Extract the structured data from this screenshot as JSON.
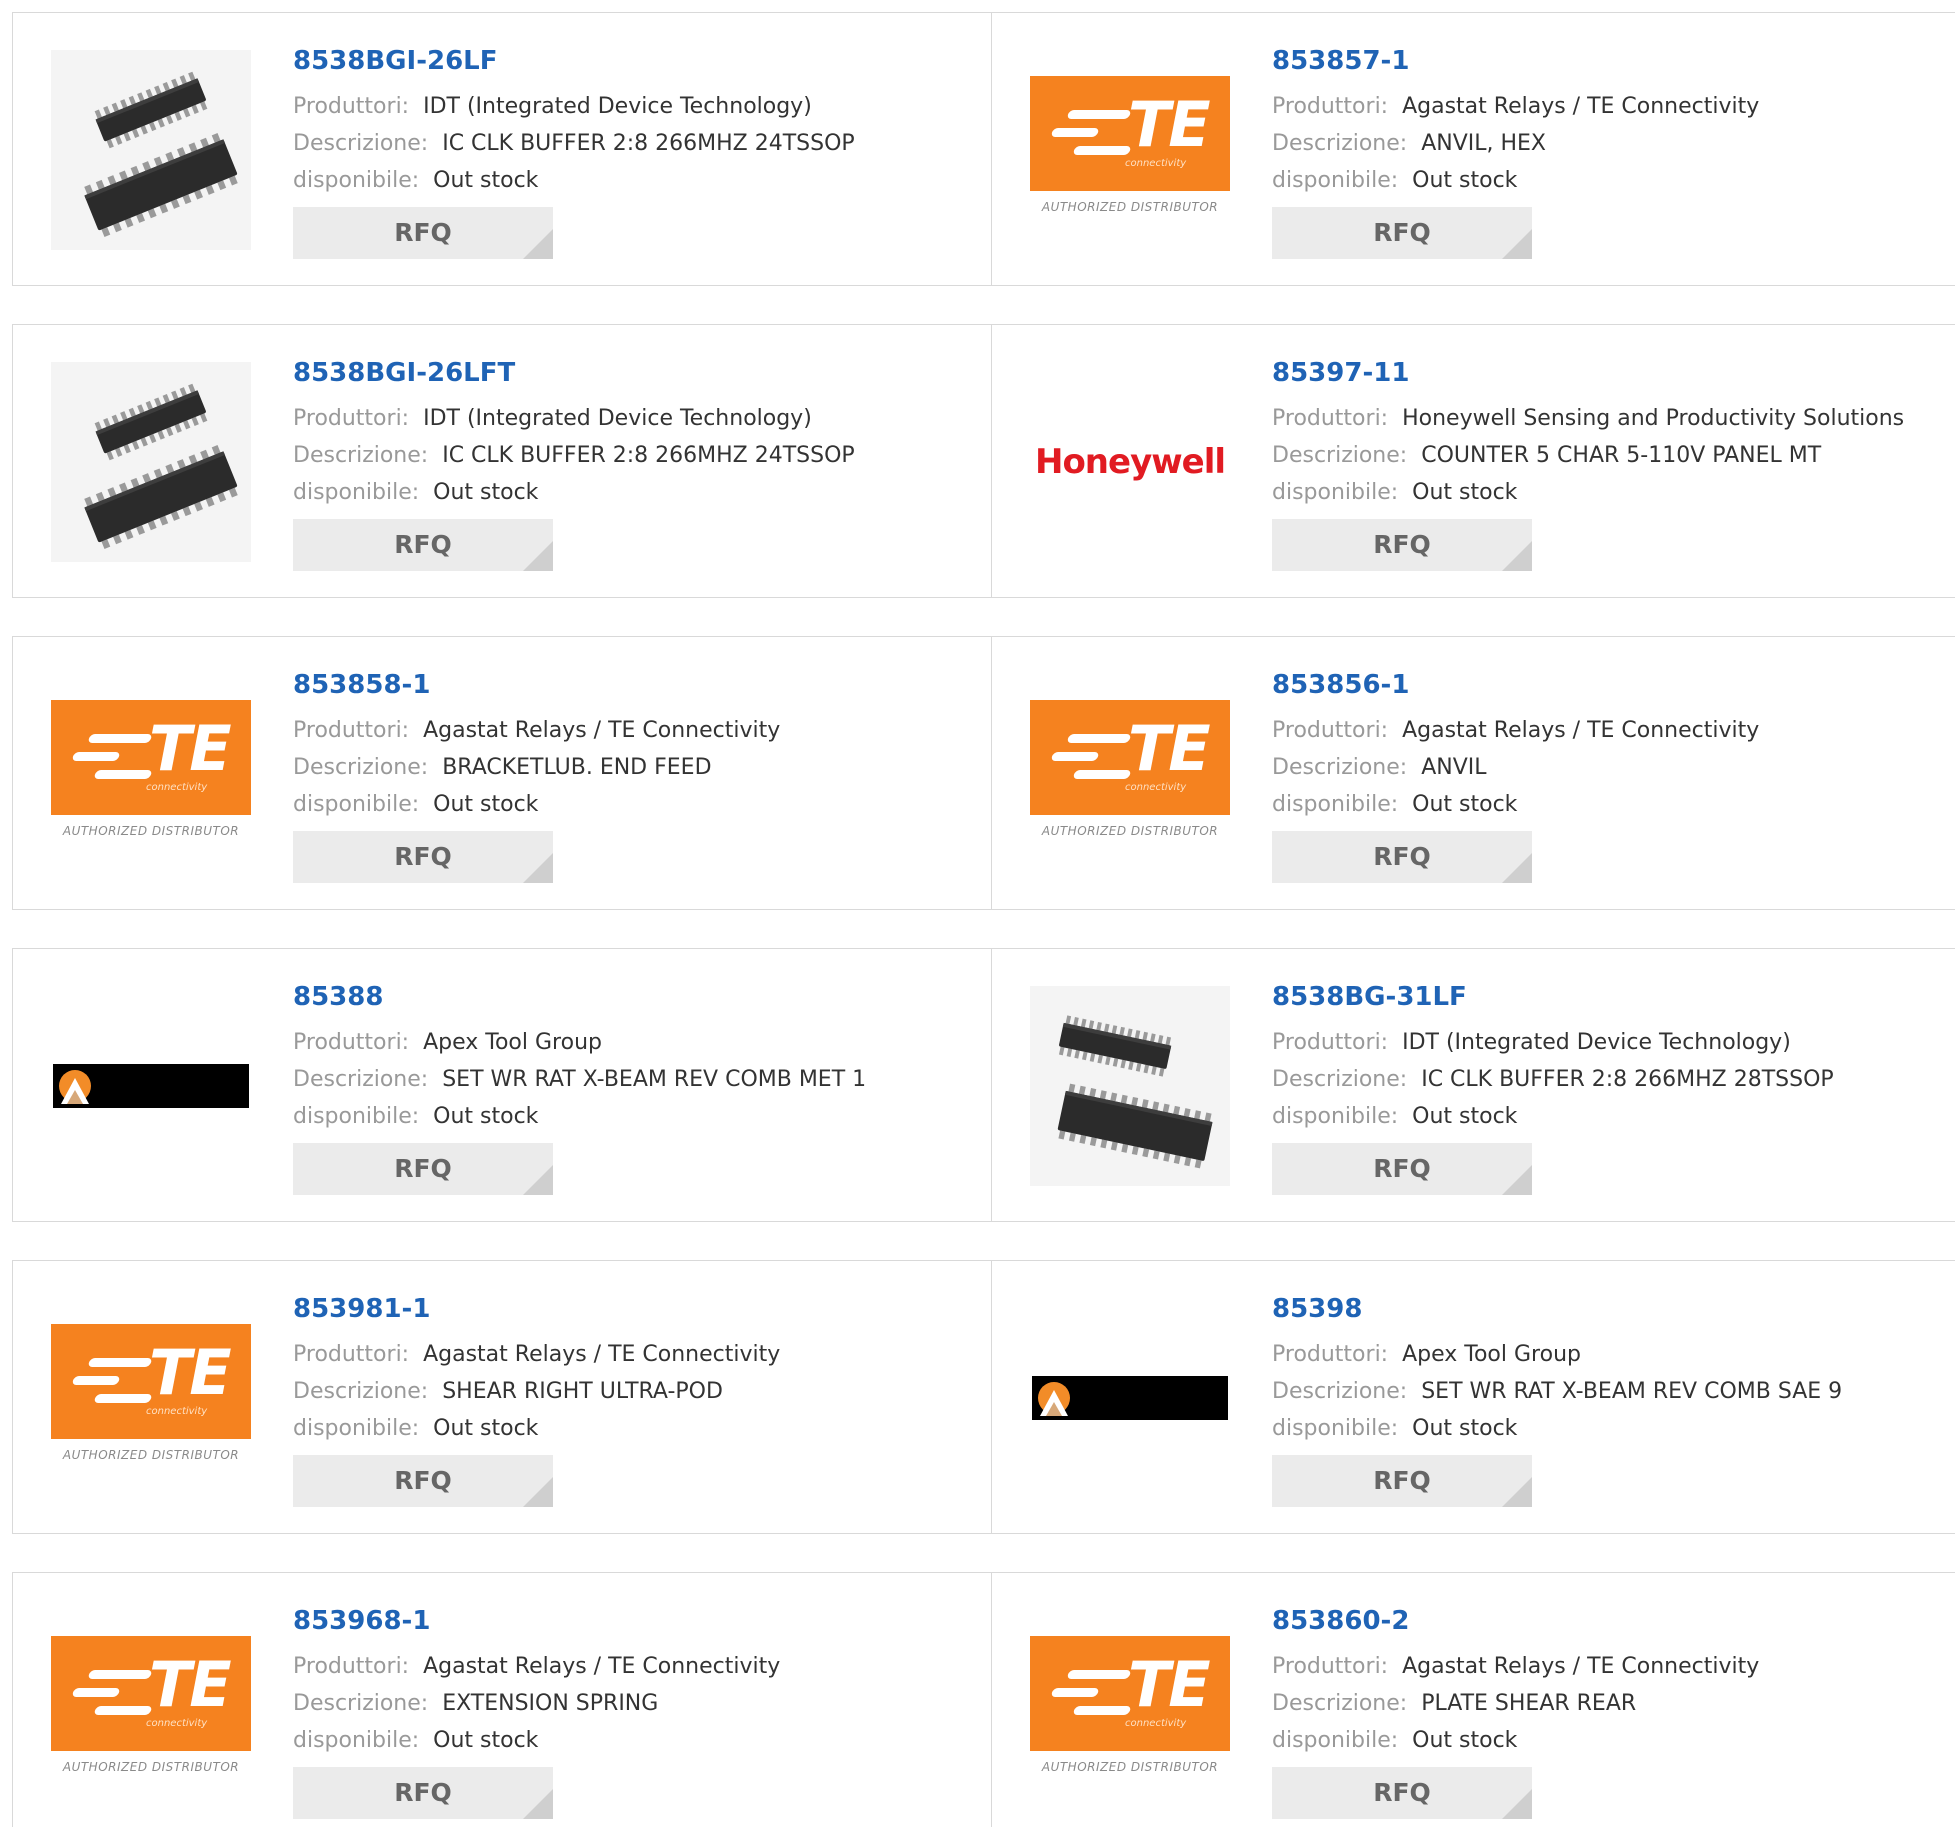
{
  "labels": {
    "manufacturer": "Produttori:",
    "description": "Descrizione:",
    "availability": "disponibile:",
    "rfq": "RFQ"
  },
  "logos": {
    "te_word": "TE",
    "te_sub": "connectivity",
    "te_authorized": "AUTHORIZED DISTRIBUTOR",
    "honeywell_word": "Honeywell"
  },
  "colors": {
    "part_link": "#1f63b5",
    "te_orange": "#f5821f",
    "honeywell_red": "#e11b22"
  },
  "products": [
    {
      "part": "8538BGI-26LF",
      "manufacturer": "IDT (Integrated Device Technology)",
      "description": "IC CLK BUFFER 2:8 266MHZ 24TSSOP",
      "availability": "Out stock",
      "image": "chip-24tssop"
    },
    {
      "part": "853857-1",
      "manufacturer": "Agastat Relays / TE Connectivity",
      "description": "ANVIL, HEX",
      "availability": "Out stock",
      "image": "te-logo"
    },
    {
      "part": "8538BGI-26LFT",
      "manufacturer": "IDT (Integrated Device Technology)",
      "description": "IC CLK BUFFER 2:8 266MHZ 24TSSOP",
      "availability": "Out stock",
      "image": "chip-24tssop"
    },
    {
      "part": "85397-11",
      "manufacturer": "Honeywell Sensing and Productivity Solutions",
      "description": "COUNTER 5 CHAR 5-110V PANEL MT",
      "availability": "Out stock",
      "image": "honeywell-logo"
    },
    {
      "part": "853858-1",
      "manufacturer": "Agastat Relays / TE Connectivity",
      "description": "BRACKETLUB. END FEED",
      "availability": "Out stock",
      "image": "te-logo"
    },
    {
      "part": "853856-1",
      "manufacturer": "Agastat Relays / TE Connectivity",
      "description": "ANVIL",
      "availability": "Out stock",
      "image": "te-logo"
    },
    {
      "part": "85388",
      "manufacturer": "Apex Tool Group",
      "description": "SET WR RAT X-BEAM REV COMB MET 1",
      "availability": "Out stock",
      "image": "apex-logo"
    },
    {
      "part": "8538BG-31LF",
      "manufacturer": "IDT (Integrated Device Technology)",
      "description": "IC CLK BUFFER 2:8 266MHZ 28TSSOP",
      "availability": "Out stock",
      "image": "chip-28tssop"
    },
    {
      "part": "853981-1",
      "manufacturer": "Agastat Relays / TE Connectivity",
      "description": "SHEAR RIGHT ULTRA-POD",
      "availability": "Out stock",
      "image": "te-logo"
    },
    {
      "part": "85398",
      "manufacturer": "Apex Tool Group",
      "description": "SET WR RAT X-BEAM REV COMB SAE 9",
      "availability": "Out stock",
      "image": "apex-logo"
    },
    {
      "part": "853968-1",
      "manufacturer": "Agastat Relays / TE Connectivity",
      "description": "EXTENSION SPRING",
      "availability": "Out stock",
      "image": "te-logo"
    },
    {
      "part": "853860-2",
      "manufacturer": "Agastat Relays / TE Connectivity",
      "description": "PLATE SHEAR REAR",
      "availability": "Out stock",
      "image": "te-logo"
    }
  ]
}
